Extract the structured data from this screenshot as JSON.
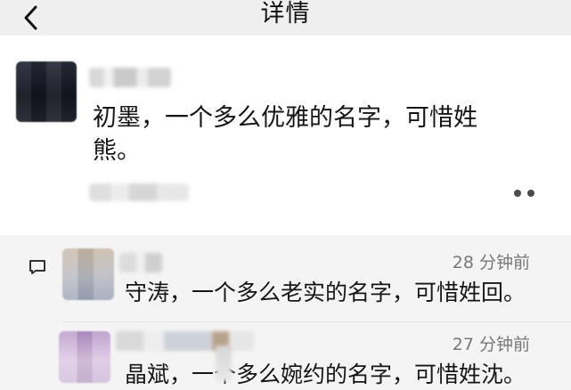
{
  "header": {
    "title": "详情"
  },
  "post": {
    "text": "初墨，一个多么优雅的名字，可惜姓熊。"
  },
  "comments": [
    {
      "time": "28 分钟前",
      "text": "守涛，一个多么老实的名字，可惜姓回。"
    },
    {
      "time": "27 分钟前",
      "text": "晶斌，一个多么婉约的名字，可惜姓沈。"
    }
  ],
  "icons": {
    "back": "chevron-left",
    "more": "more-horizontal",
    "comment": "comment"
  }
}
